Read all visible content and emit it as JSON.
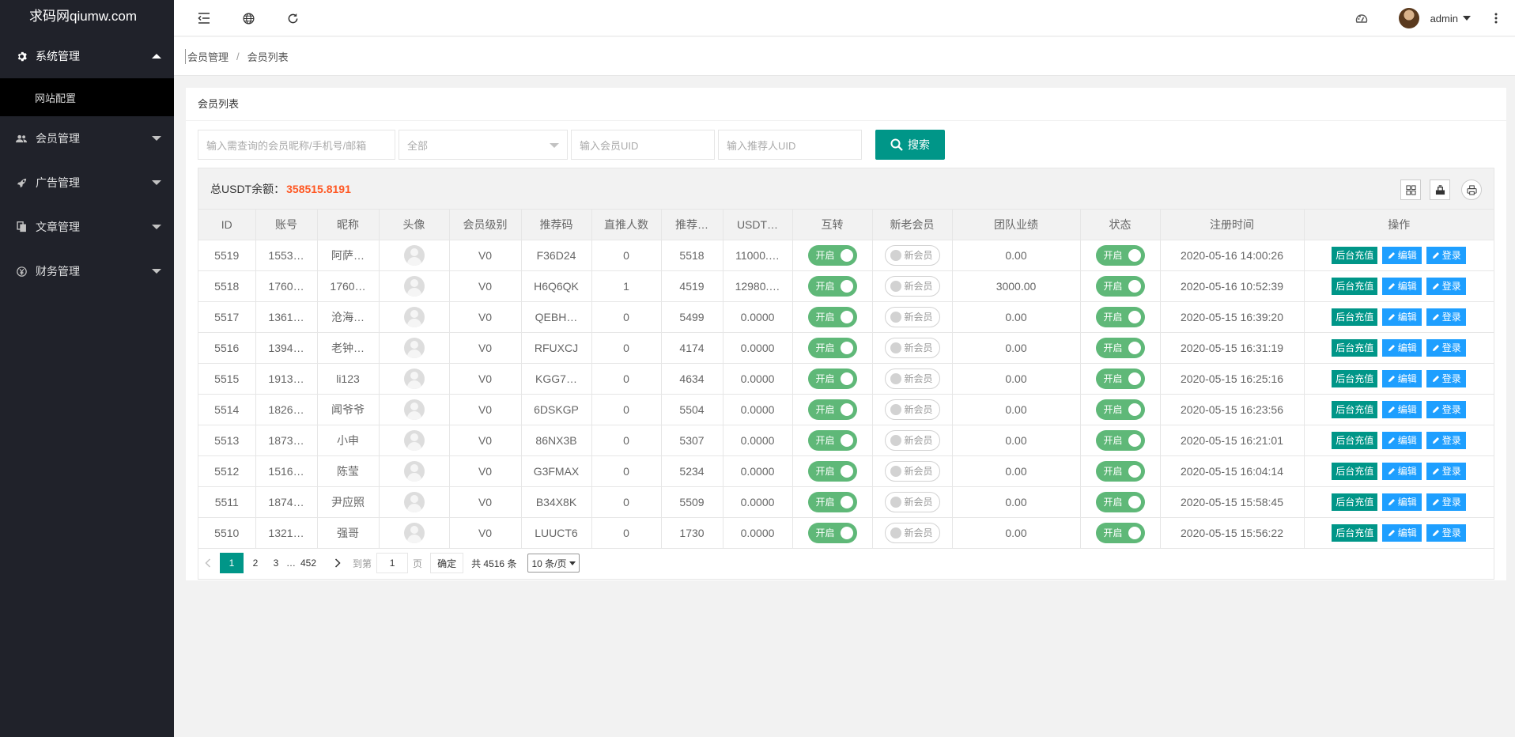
{
  "sidebar": {
    "logo": "求码网qiumw.com",
    "items": [
      {
        "label": "系统管理",
        "icon": "gear-icon",
        "expanded": true,
        "children": [
          {
            "label": "网站配置"
          }
        ]
      },
      {
        "label": "会员管理",
        "icon": "users-icon"
      },
      {
        "label": "广告管理",
        "icon": "rocket-icon"
      },
      {
        "label": "文章管理",
        "icon": "copy-icon"
      },
      {
        "label": "财务管理",
        "icon": "yen-icon"
      }
    ]
  },
  "header": {
    "user": "admin"
  },
  "breadcrumb": [
    "会员管理",
    "会员列表"
  ],
  "card": {
    "title": "会员列表"
  },
  "filters": {
    "keyword_placeholder": "输入需查询的会员昵称/手机号/邮箱",
    "level_selected": "全部",
    "uid_placeholder": "输入会员UID",
    "referrer_placeholder": "输入推荐人UID",
    "search_label": "搜索"
  },
  "summary": {
    "label": "总USDT余额：",
    "value": "358515.8191"
  },
  "table": {
    "columns": [
      "ID",
      "账号",
      "昵称",
      "头像",
      "会员级别",
      "推荐码",
      "直推人数",
      "推荐…",
      "USDT…",
      "互转",
      "新老会员",
      "团队业绩",
      "状态",
      "注册时间",
      "操作"
    ],
    "toggle_on": "开启",
    "new_member": "新会员",
    "actions": {
      "recharge": "后台充值",
      "edit": "编辑",
      "login": "登录"
    },
    "rows": [
      {
        "id": "5519",
        "account": "1553…",
        "nick": "阿萨…",
        "level": "V0",
        "code": "F36D24",
        "direct": "0",
        "ref": "5518",
        "usdt": "11000.…",
        "perf": "0.00",
        "time": "2020-05-16 14:00:26"
      },
      {
        "id": "5518",
        "account": "1760…",
        "nick": "1760…",
        "level": "V0",
        "code": "H6Q6QK",
        "direct": "1",
        "ref": "4519",
        "usdt": "12980.…",
        "perf": "3000.00",
        "time": "2020-05-16 10:52:39"
      },
      {
        "id": "5517",
        "account": "1361…",
        "nick": "沧海…",
        "level": "V0",
        "code": "QEBH…",
        "direct": "0",
        "ref": "5499",
        "usdt": "0.0000",
        "perf": "0.00",
        "time": "2020-05-15 16:39:20"
      },
      {
        "id": "5516",
        "account": "1394…",
        "nick": "老钟…",
        "level": "V0",
        "code": "RFUXCJ",
        "direct": "0",
        "ref": "4174",
        "usdt": "0.0000",
        "perf": "0.00",
        "time": "2020-05-15 16:31:19"
      },
      {
        "id": "5515",
        "account": "1913…",
        "nick": "li123",
        "level": "V0",
        "code": "KGG7…",
        "direct": "0",
        "ref": "4634",
        "usdt": "0.0000",
        "perf": "0.00",
        "time": "2020-05-15 16:25:16"
      },
      {
        "id": "5514",
        "account": "1826…",
        "nick": "闻爷爷",
        "level": "V0",
        "code": "6DSKGP",
        "direct": "0",
        "ref": "5504",
        "usdt": "0.0000",
        "perf": "0.00",
        "time": "2020-05-15 16:23:56"
      },
      {
        "id": "5513",
        "account": "1873…",
        "nick": "小申",
        "level": "V0",
        "code": "86NX3B",
        "direct": "0",
        "ref": "5307",
        "usdt": "0.0000",
        "perf": "0.00",
        "time": "2020-05-15 16:21:01"
      },
      {
        "id": "5512",
        "account": "1516…",
        "nick": "陈莹",
        "level": "V0",
        "code": "G3FMAX",
        "direct": "0",
        "ref": "5234",
        "usdt": "0.0000",
        "perf": "0.00",
        "time": "2020-05-15 16:04:14"
      },
      {
        "id": "5511",
        "account": "1874…",
        "nick": "尹应照",
        "level": "V0",
        "code": "B34X8K",
        "direct": "0",
        "ref": "5509",
        "usdt": "0.0000",
        "perf": "0.00",
        "time": "2020-05-15 15:58:45"
      },
      {
        "id": "5510",
        "account": "1321…",
        "nick": "强哥",
        "level": "V0",
        "code": "LUUCT6",
        "direct": "0",
        "ref": "1730",
        "usdt": "0.0000",
        "perf": "0.00",
        "time": "2020-05-15 15:56:22"
      }
    ]
  },
  "pager": {
    "pages": [
      "1",
      "2",
      "3"
    ],
    "ellipsis": "…",
    "last": "452",
    "goto_label": "到第",
    "goto_value": "1",
    "page_unit": "页",
    "confirm": "确定",
    "total": "共 4516 条",
    "per_page": "10 条/页"
  }
}
